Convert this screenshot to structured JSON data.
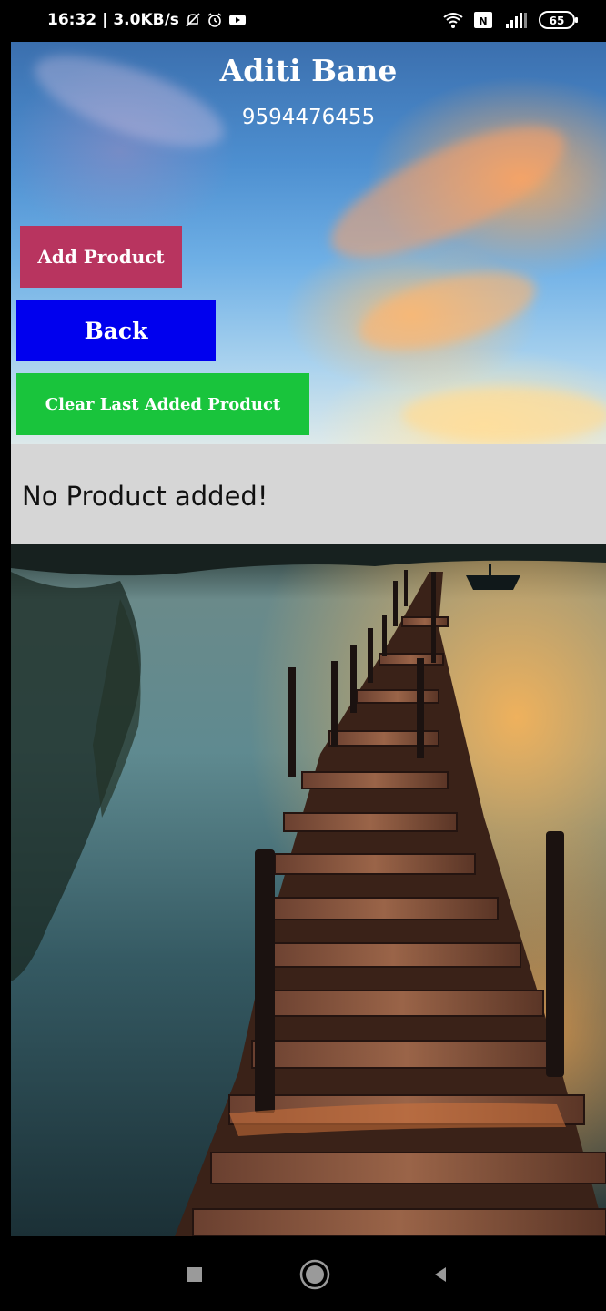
{
  "status_bar": {
    "time": "16:32",
    "speed": "3.0KB/s",
    "battery": "65"
  },
  "header": {
    "name": "Aditi Bane",
    "phone": "9594476455"
  },
  "buttons": {
    "add_product": "Add Product",
    "back": "Back",
    "clear_last": "Clear Last Added Product"
  },
  "message": {
    "text": "No Product added!"
  },
  "colors": {
    "add_product": "#b8345f",
    "back": "#0000ee",
    "clear_last": "#19c43c",
    "message_bg": "#d6d6d6"
  },
  "icons": {
    "status_left": [
      "mute-bell-icon",
      "alarm-icon",
      "youtube-icon"
    ],
    "status_right": [
      "wifi-icon",
      "nfc-icon",
      "signal-icon",
      "battery-icon"
    ],
    "nav": [
      "recents-square-icon",
      "home-circle-icon",
      "back-triangle-icon"
    ]
  }
}
